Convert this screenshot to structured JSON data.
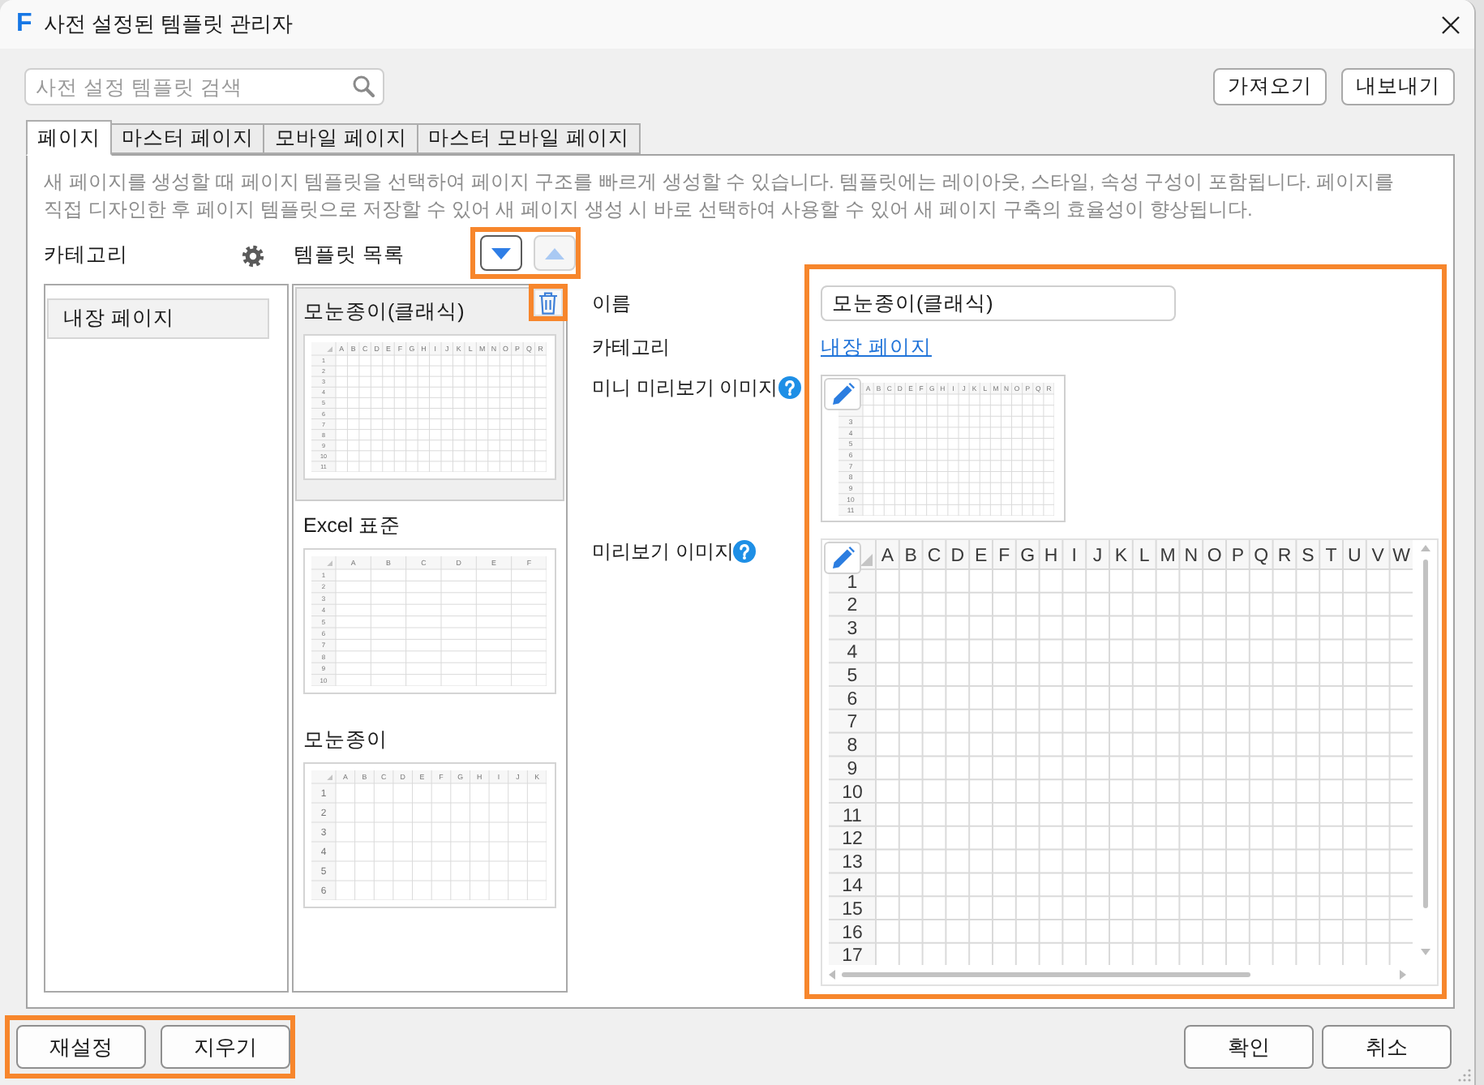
{
  "window": {
    "logo": "F",
    "title": "사전 설정된 템플릿 관리자"
  },
  "toolbar": {
    "search": {
      "placeholder": "사전 설정 템플릿 검색"
    },
    "buttons": [
      {
        "label": "가져오기"
      },
      {
        "label": "내보내기"
      }
    ]
  },
  "tabs": [
    {
      "label": "페이지",
      "selected": true
    },
    {
      "label": "마스터 페이지",
      "selected": false
    },
    {
      "label": "모바일 페이지",
      "selected": false
    },
    {
      "label": "마스터 모바일 페이지",
      "selected": false
    }
  ],
  "description": "새 페이지를 생성할 때 페이지 템플릿을 선택하여 페이지 구조를 빠르게 생성할 수 있습니다. 템플릿에는 레이아웃, 스타일, 속성 구성이 포함됩니다. 페이지를 직접 디자인한 후 페이지 템플릿으로 저장할 수 있어 새 페이지 생성 시 바로 선택하여 사용할 수 있어 새 페이지 구축의 효율성이 향상됩니다.",
  "categories": {
    "heading": "카테고리",
    "items": [
      {
        "label": "내장 페이지",
        "selected": true
      }
    ]
  },
  "templates": {
    "heading": "템플릿 목록",
    "sort_buttons": {
      "highlighted": true,
      "items": [
        {
          "kind": "down",
          "disabled": false
        },
        {
          "kind": "up",
          "disabled": true
        }
      ]
    },
    "items": [
      {
        "name": "모눈종이(클래식)",
        "selected": true,
        "delete_button": {
          "highlighted": true
        },
        "thumbnail": {
          "columns": [
            "A",
            "B",
            "C",
            "D",
            "E",
            "F",
            "G",
            "H",
            "I",
            "J",
            "K",
            "L",
            "M",
            "N",
            "O",
            "P",
            "Q",
            "R"
          ],
          "rows": [
            "1",
            "2",
            "3",
            "4",
            "5",
            "6",
            "7",
            "8",
            "9",
            "10",
            "11"
          ]
        }
      },
      {
        "name": "Excel 표준",
        "selected": false,
        "thumbnail": {
          "columns": [
            "A",
            "B",
            "C",
            "D",
            "E",
            "F"
          ],
          "rows": [
            "1",
            "2",
            "3",
            "4",
            "5",
            "6",
            "7",
            "8",
            "9",
            "10"
          ]
        }
      },
      {
        "name": "모눈종이",
        "selected": false,
        "thumbnail": {
          "columns": [
            "A",
            "B",
            "C",
            "D",
            "E",
            "F",
            "G",
            "H",
            "I",
            "J",
            "K"
          ],
          "rows": [
            "1",
            "2",
            "3",
            "4",
            "5",
            "6"
          ]
        }
      }
    ]
  },
  "details": {
    "highlighted": true,
    "name": {
      "label": "이름",
      "value": "모눈종이(클래식)"
    },
    "category": {
      "label": "카테고리",
      "link": "내장 페이지"
    },
    "mini_preview": {
      "label": "미니 미리보기 이미지",
      "columns": [
        "A",
        "B",
        "C",
        "D",
        "E",
        "F",
        "G",
        "H",
        "I",
        "J",
        "K",
        "L",
        "M",
        "N",
        "O",
        "P",
        "Q",
        "R"
      ],
      "rows": [
        "3",
        "4",
        "5",
        "6",
        "7",
        "8",
        "9",
        "10",
        "11"
      ]
    },
    "preview": {
      "label": "미리보기 이미지",
      "columns": [
        "A",
        "B",
        "C",
        "D",
        "E",
        "F",
        "G",
        "H",
        "I",
        "J",
        "K",
        "L",
        "M",
        "N",
        "O",
        "P",
        "Q",
        "R",
        "S",
        "T",
        "U",
        "V",
        "W"
      ],
      "rows": [
        "1",
        "2",
        "3",
        "4",
        "5",
        "6",
        "7",
        "8",
        "9",
        "10",
        "11",
        "12",
        "13",
        "14",
        "15",
        "16",
        "17"
      ]
    }
  },
  "footer": {
    "left": {
      "highlighted": true,
      "buttons": [
        {
          "label": "재설정"
        },
        {
          "label": "지우기"
        }
      ]
    },
    "right": {
      "buttons": [
        {
          "label": "확인"
        },
        {
          "label": "취소"
        }
      ]
    }
  }
}
